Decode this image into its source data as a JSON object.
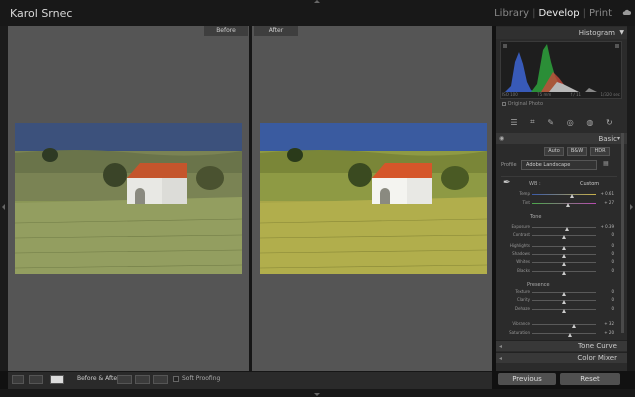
{
  "identity_plate": "Karol Srnec",
  "modules": {
    "library": "Library",
    "develop": "Develop",
    "print": "Print",
    "sep": "|"
  },
  "views": {
    "before": "Before",
    "after": "After"
  },
  "toolbar": {
    "mode_label": "Before & After",
    "soft_proofing": "Soft Proofing"
  },
  "histogram": {
    "title": "Histogram",
    "readout": {
      "iso": "ISO 100",
      "focal": "75 mm",
      "aperture": "f / 11",
      "shutter": "1/320 sec"
    },
    "original_photo": "Original Photo"
  },
  "basic": {
    "title": "Basic",
    "treatment_buttons": [
      "Auto",
      "B&W",
      "HDR"
    ],
    "profile_label": "Profile",
    "profile_value": "Adobe Landscape",
    "wb_label": "WB :",
    "wb_value": "Custom",
    "tone_label": "Tone",
    "presence_label": "Presence",
    "sliders": [
      {
        "label": "Temp",
        "value": "+ 0.61",
        "level": 0.62
      },
      {
        "label": "Tint",
        "value": "+ 27",
        "level": 0.56
      },
      {
        "label": "Exposure",
        "value": "+ 0.39",
        "level": 0.54
      },
      {
        "label": "Contrast",
        "value": "0",
        "level": 0.5
      },
      {
        "label": "Highlights",
        "value": "0",
        "level": 0.5
      },
      {
        "label": "Shadows",
        "value": "0",
        "level": 0.5
      },
      {
        "label": "Whites",
        "value": "0",
        "level": 0.5
      },
      {
        "label": "Blacks",
        "value": "0",
        "level": 0.5
      },
      {
        "label": "Texture",
        "value": "0",
        "level": 0.5
      },
      {
        "label": "Clarity",
        "value": "0",
        "level": 0.5
      },
      {
        "label": "Dehaze",
        "value": "0",
        "level": 0.5
      },
      {
        "label": "Vibrance",
        "value": "+ 32",
        "level": 0.66
      },
      {
        "label": "Saturation",
        "value": "+ 20",
        "level": 0.6
      }
    ]
  },
  "panels": {
    "tone_curve": "Tone Curve",
    "color_mixer": "Color Mixer"
  },
  "buttons": {
    "previous": "Previous",
    "reset": "Reset"
  },
  "icons": [
    "cloud-icon",
    "eyedropper-icon",
    "edit-sliders-icon",
    "crop-icon",
    "heal-icon",
    "redeye-icon",
    "mask-icon",
    "presets-icon"
  ],
  "colors": {
    "panel_bg": "#2b2b2b",
    "canvas_bg": "#555555",
    "sky": "#3a5ba0",
    "field": "#8e9a44",
    "roof": "#c4552c"
  }
}
